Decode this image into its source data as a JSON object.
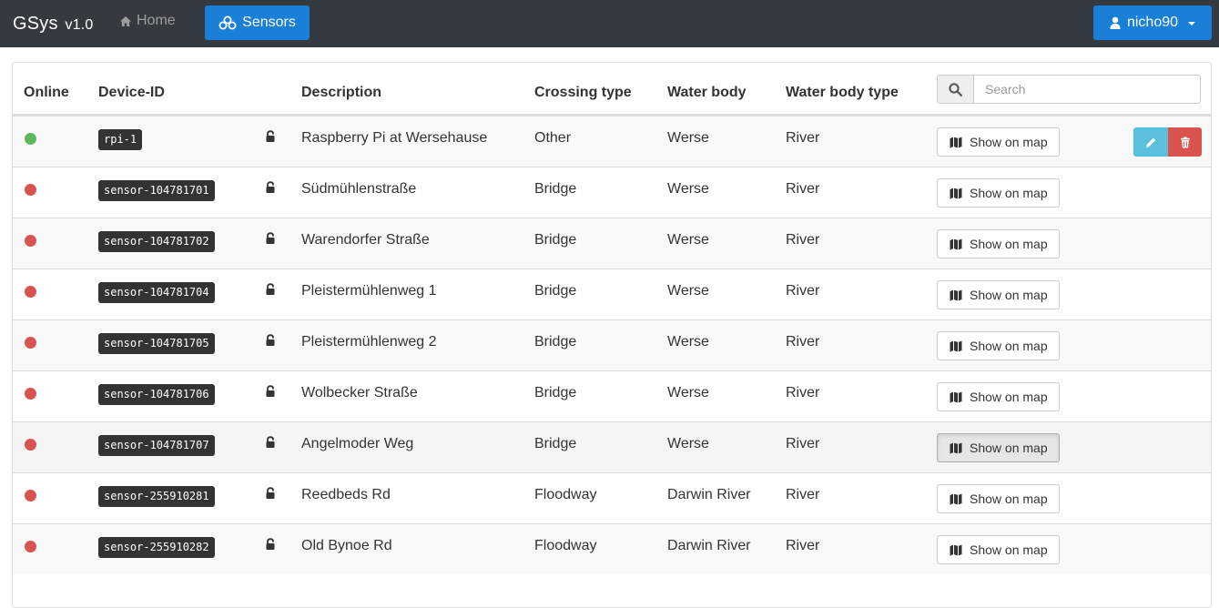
{
  "navbar": {
    "brand": "GSys",
    "version": "v1.0",
    "home_label": "Home",
    "sensors_label": "Sensors",
    "user_label": "nicho90"
  },
  "table": {
    "headers": {
      "online": "Online",
      "device_id": "Device-ID",
      "description": "Description",
      "crossing_type": "Crossing type",
      "water_body": "Water body",
      "water_body_type": "Water body type"
    },
    "search_placeholder": "Search",
    "show_on_map_label": "Show on map",
    "rows": [
      {
        "online": true,
        "device_id": "rpi-1",
        "description": "Raspberry Pi at Wersehause",
        "crossing_type": "Other",
        "water_body": "Werse",
        "water_body_type": "River"
      },
      {
        "online": false,
        "device_id": "sensor-104781701",
        "description": "Südmühlenstraße",
        "crossing_type": "Bridge",
        "water_body": "Werse",
        "water_body_type": "River"
      },
      {
        "online": false,
        "device_id": "sensor-104781702",
        "description": "Warendorfer Straße",
        "crossing_type": "Bridge",
        "water_body": "Werse",
        "water_body_type": "River"
      },
      {
        "online": false,
        "device_id": "sensor-104781704",
        "description": "Pleistermühlenweg 1",
        "crossing_type": "Bridge",
        "water_body": "Werse",
        "water_body_type": "River"
      },
      {
        "online": false,
        "device_id": "sensor-104781705",
        "description": "Pleistermühlenweg 2",
        "crossing_type": "Bridge",
        "water_body": "Werse",
        "water_body_type": "River"
      },
      {
        "online": false,
        "device_id": "sensor-104781706",
        "description": "Wolbecker Straße",
        "crossing_type": "Bridge",
        "water_body": "Werse",
        "water_body_type": "River"
      },
      {
        "online": false,
        "device_id": "sensor-104781707",
        "description": "Angelmoder Weg",
        "crossing_type": "Bridge",
        "water_body": "Werse",
        "water_body_type": "River"
      },
      {
        "online": false,
        "device_id": "sensor-255910281",
        "description": "Reedbeds Rd",
        "crossing_type": "Floodway",
        "water_body": "Darwin River",
        "water_body_type": "River"
      },
      {
        "online": false,
        "device_id": "sensor-255910282",
        "description": "Old Bynoe Rd",
        "crossing_type": "Floodway",
        "water_body": "Darwin River",
        "water_body_type": "River"
      }
    ]
  },
  "colors": {
    "navbar_bg": "#343a40",
    "primary": "#1a7fd6",
    "online": "#5cb85c",
    "offline": "#d9534f",
    "edit": "#5bc0de",
    "delete": "#d9534f"
  }
}
